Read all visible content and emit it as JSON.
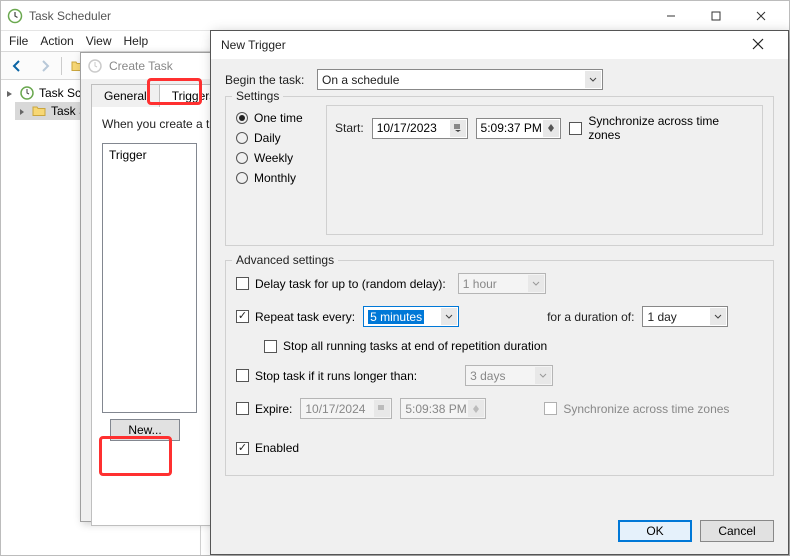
{
  "app": {
    "title": "Task Scheduler"
  },
  "menu": {
    "file": "File",
    "action": "Action",
    "view": "View",
    "help": "Help"
  },
  "tree": {
    "root": "Task Scheduler",
    "lib": "Task Scheduler Library"
  },
  "ct": {
    "title": "Create Task",
    "tab_general": "General",
    "tab_triggers": "Triggers",
    "hint": "When you create a task, you must specify the action that will occur when your task starts.",
    "col_trigger": "Trigger",
    "new_btn": "New..."
  },
  "nt": {
    "title": "New Trigger",
    "begin_label": "Begin the task:",
    "begin_value": "On a schedule",
    "settings_legend": "Settings",
    "radio_one": "One time",
    "radio_daily": "Daily",
    "radio_weekly": "Weekly",
    "radio_monthly": "Monthly",
    "start_label": "Start:",
    "start_date": "10/17/2023",
    "start_time": "5:09:37 PM",
    "sync_tz": "Synchronize across time zones",
    "adv_legend": "Advanced settings",
    "delay_label": "Delay task for up to (random delay):",
    "delay_value": "1 hour",
    "repeat_label": "Repeat task every:",
    "repeat_value": "5 minutes",
    "duration_label": "for a duration of:",
    "duration_value": "1 day",
    "stop_all": "Stop all running tasks at end of repetition duration",
    "stop_longer": "Stop task if it runs longer than:",
    "stop_longer_value": "3 days",
    "expire_label": "Expire:",
    "expire_date": "10/17/2024",
    "expire_time": "5:09:38 PM",
    "sync_tz2": "Synchronize across time zones",
    "enabled": "Enabled",
    "ok": "OK",
    "cancel": "Cancel"
  }
}
